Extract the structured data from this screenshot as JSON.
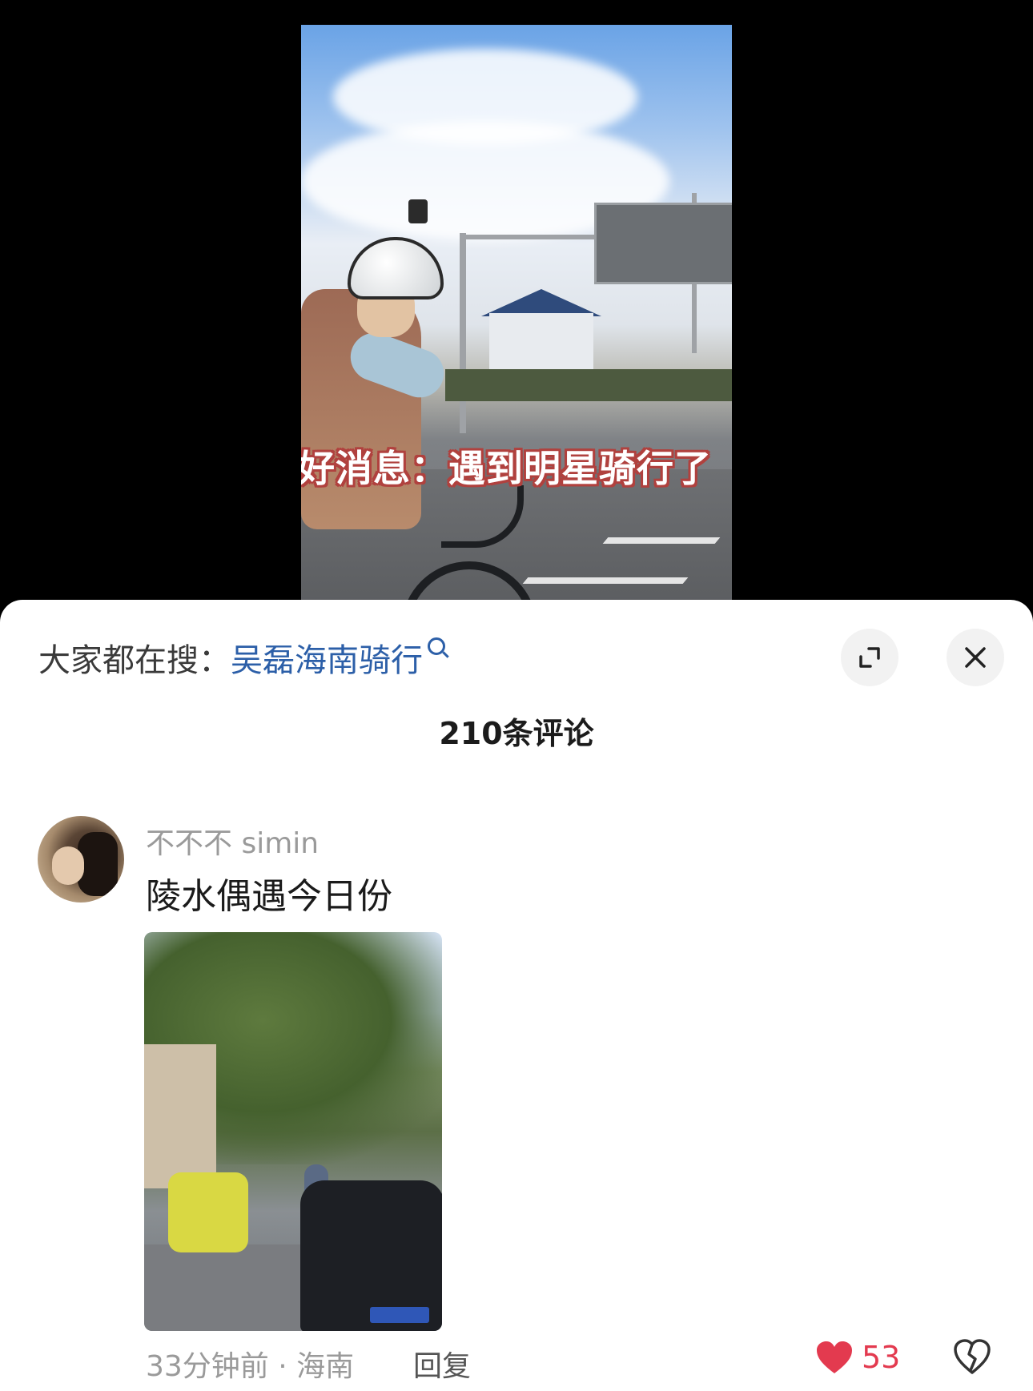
{
  "video": {
    "caption": "好消息：遇到明星骑行了"
  },
  "sheet": {
    "search_prefix": "大家都在搜：",
    "search_term": "吴磊海南骑行",
    "comment_count": "210条评论"
  },
  "comment": {
    "username": "不不不 simin",
    "text": "陵水偶遇今日份",
    "time_location": "33分钟前 · 海南",
    "reply_label": "回复",
    "like_count": "53"
  },
  "colors": {
    "link": "#2c5fa8",
    "like": "#e33a4f"
  },
  "icons": [
    "search-icon",
    "expand-icon",
    "close-icon",
    "heart-icon",
    "dislike-icon"
  ]
}
